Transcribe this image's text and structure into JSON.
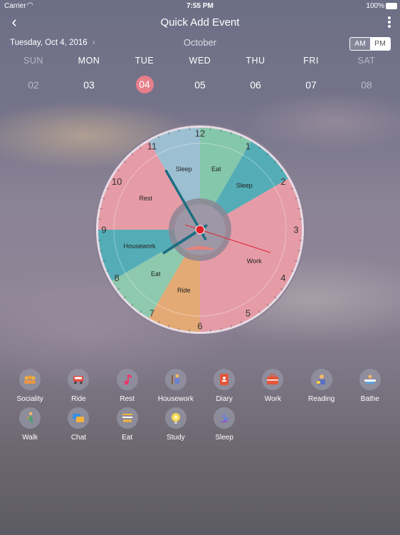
{
  "status": {
    "carrier": "Carrier",
    "time": "7:55 PM",
    "battery": "100%"
  },
  "nav": {
    "title": "Quick Add Event"
  },
  "header": {
    "date": "Tuesday, Oct 4, 2016",
    "month": "October",
    "am": "AM",
    "pm": "PM",
    "selected_period": "PM"
  },
  "week": [
    {
      "name": "SUN",
      "date": "02"
    },
    {
      "name": "MON",
      "date": "03"
    },
    {
      "name": "TUE",
      "date": "04",
      "selected": true
    },
    {
      "name": "WED",
      "date": "05"
    },
    {
      "name": "THU",
      "date": "06"
    },
    {
      "name": "FRI",
      "date": "07"
    },
    {
      "name": "SAT",
      "date": "08"
    }
  ],
  "clock": {
    "numbers": [
      "12",
      "1",
      "2",
      "3",
      "4",
      "5",
      "6",
      "7",
      "8",
      "9",
      "10",
      "11"
    ],
    "segments": [
      {
        "label": "Eat",
        "start": 0,
        "end": 1,
        "color": "#7cc4a6"
      },
      {
        "label": "Sleep",
        "start": 1,
        "end": 2,
        "color": "#46a8b2"
      },
      {
        "label": "Work",
        "start": 2,
        "end": 6,
        "color": "#e496a2"
      },
      {
        "label": "Ride",
        "start": 6,
        "end": 7,
        "color": "#e3a56b"
      },
      {
        "label": "Eat",
        "start": 7,
        "end": 8,
        "color": "#86c7a8"
      },
      {
        "label": "Housework",
        "start": 8,
        "end": 9,
        "color": "#46a8b2"
      },
      {
        "label": "Rest",
        "start": 9,
        "end": 11,
        "color": "#e496a2"
      },
      {
        "label": "Sleep",
        "start": 11,
        "end": 12,
        "color": "#95bdd0"
      }
    ],
    "time": {
      "hour": 7,
      "minute": 55,
      "second": 18
    }
  },
  "activities": [
    {
      "label": "Sociality",
      "icon": "sociality-icon"
    },
    {
      "label": "Ride",
      "icon": "car-icon"
    },
    {
      "label": "Rest",
      "icon": "music-note-icon"
    },
    {
      "label": "Housework",
      "icon": "housework-icon"
    },
    {
      "label": "Diary",
      "icon": "diary-icon"
    },
    {
      "label": "Work",
      "icon": "briefcase-icon"
    },
    {
      "label": "Reading",
      "icon": "reading-icon"
    },
    {
      "label": "Bathe",
      "icon": "bathtub-icon"
    },
    {
      "label": "Walk",
      "icon": "walking-icon"
    },
    {
      "label": "Chat",
      "icon": "chat-icon"
    },
    {
      "label": "Eat",
      "icon": "food-icon"
    },
    {
      "label": "Study",
      "icon": "lightbulb-icon"
    },
    {
      "label": "Sleep",
      "icon": "moon-icon"
    }
  ]
}
